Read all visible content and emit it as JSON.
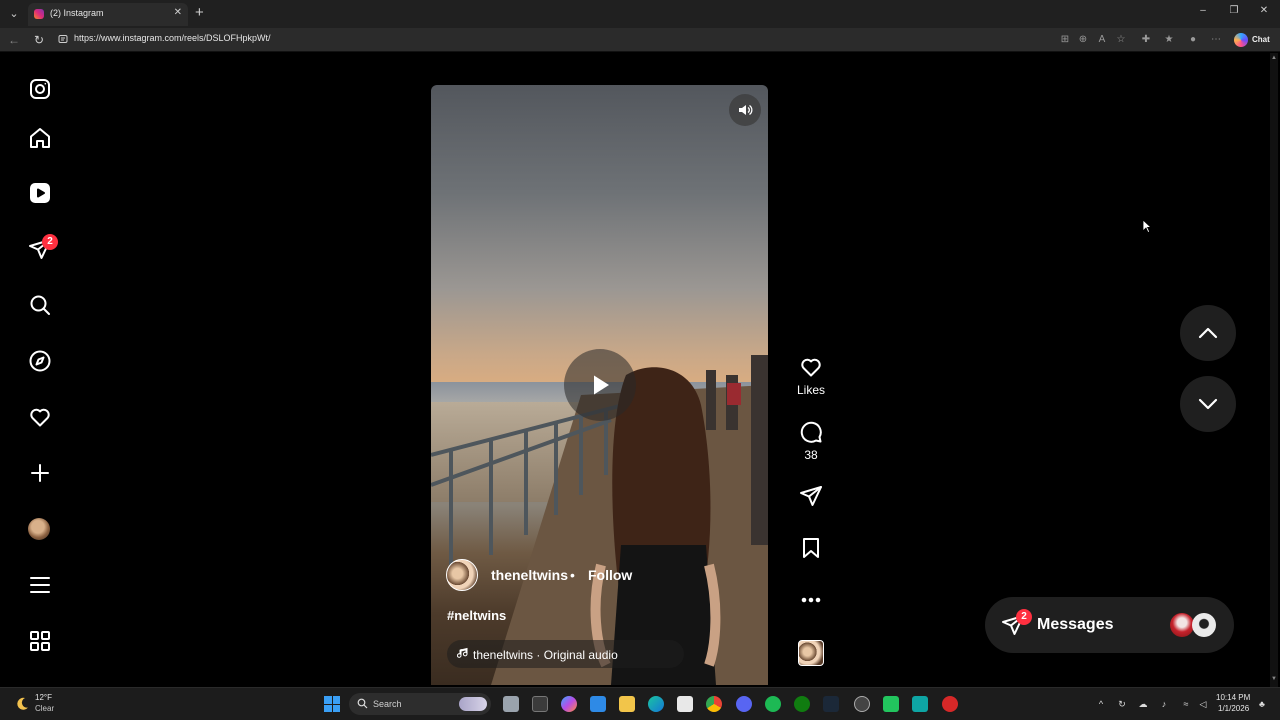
{
  "browser": {
    "tab_title": "(2) Instagram",
    "tab_close": "✕",
    "new_tab": "+",
    "url": "https://www.instagram.com/reels/DSLOFHpkpWt/",
    "chat_label": "Chat",
    "window_controls": [
      "–",
      "❐",
      "✕"
    ]
  },
  "sidebar": {
    "items": [
      {
        "name": "instagram-logo-icon"
      },
      {
        "name": "home-icon"
      },
      {
        "name": "reels-icon"
      },
      {
        "name": "direct-messages-icon"
      },
      {
        "name": "search-icon"
      },
      {
        "name": "explore-icon"
      },
      {
        "name": "notifications-heart-icon"
      },
      {
        "name": "create-plus-icon"
      },
      {
        "name": "profile-avatar"
      },
      {
        "name": "more-menu-icon"
      },
      {
        "name": "also-from-meta-icon"
      }
    ],
    "messages_badge": "2"
  },
  "reel": {
    "username": "theneltwins",
    "separator": "•",
    "follow_label": "Follow",
    "caption": "#neltwins",
    "audio": "theneltwins · Original audio"
  },
  "actions": {
    "likes_label": "Likes",
    "comments_count": "38"
  },
  "messages": {
    "label": "Messages",
    "badge": "2"
  },
  "taskbar": {
    "weather_temp": "12°F",
    "weather_condition": "Clear",
    "search_placeholder": "Search",
    "time": "10:14 PM",
    "date": "1/1/2026"
  },
  "colors": {
    "badge_red": "#ff3040",
    "page_bg": "#000000",
    "nav_button_bg": "#1f1f1f"
  }
}
